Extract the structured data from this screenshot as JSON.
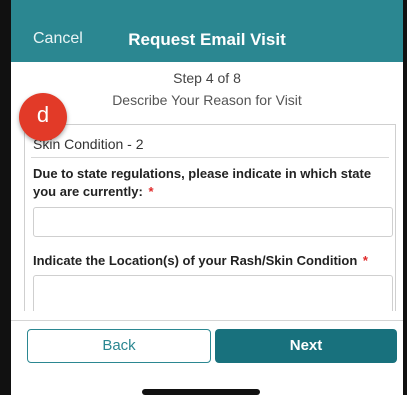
{
  "header": {
    "cancel_label": "Cancel",
    "title": "Request Email Visit"
  },
  "progress": {
    "step_text": "Step 4 of 8",
    "subtitle": "Describe Your Reason for Visit"
  },
  "annotation_badge": "d",
  "card": {
    "heading": "Skin Condition - 2",
    "question_1": "Due to state regulations, please indicate in which state you are currently:",
    "question_2": "Indicate the Location(s) of your Rash/Skin Condition",
    "required_marker": "*",
    "field_1_value": "",
    "field_2_value": ""
  },
  "footer": {
    "back_label": "Back",
    "next_label": "Next"
  },
  "colors": {
    "header_bg": "#2b8791",
    "next_bg": "#18717d",
    "required": "#e02a2a",
    "badge": "#e23a28"
  }
}
